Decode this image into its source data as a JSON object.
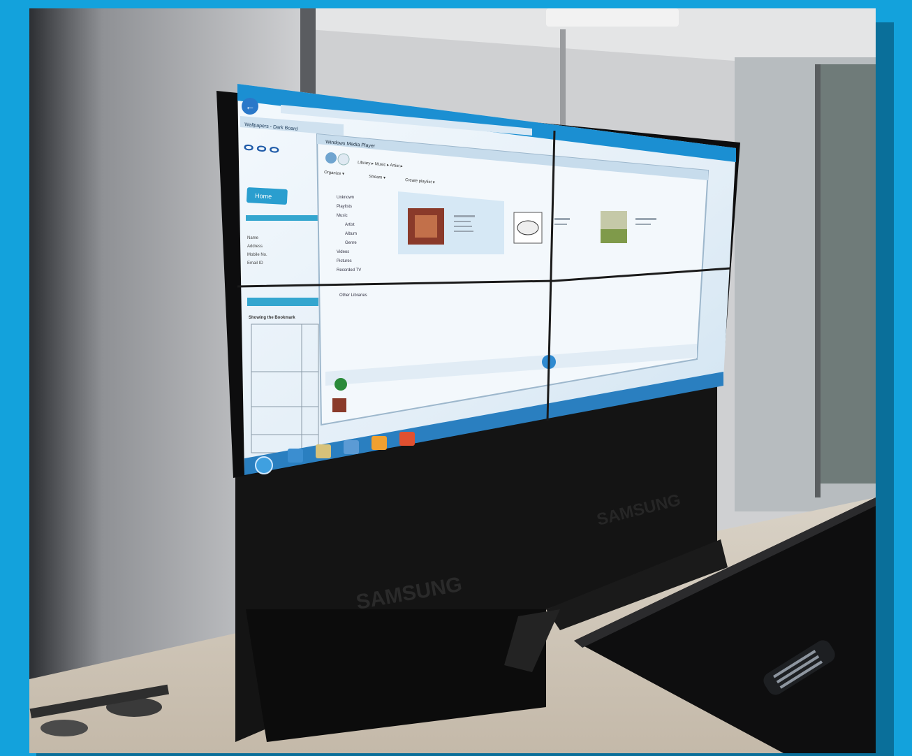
{
  "photo": {
    "brand_front": "SAMSUNG",
    "brand_side": "SAMSUNG"
  },
  "media_player": {
    "window_title": "Windows Media Player",
    "breadcrumb": "Library ▸ Music ▸ Artist ▸",
    "toolbar": [
      "Organize ▾",
      "Stream ▾",
      "Create playlist ▾"
    ],
    "nav_items": [
      "Unknown",
      "Playlists",
      "Music",
      "Artist",
      "Album",
      "Genre",
      "Videos",
      "Pictures",
      "Recorded TV"
    ],
    "other_libraries": "Other Libraries"
  },
  "browser": {
    "tab_label": "Wallpapers - Dark Board",
    "home_tab": "Home",
    "fields": [
      "Name",
      "Address",
      "Mobile No.",
      "Email ID"
    ],
    "section_heading": "Showing the Bookmark"
  },
  "colors": {
    "border_blue": "#13a2dc",
    "screen_glow": "#dfeef8",
    "taskbar": "#2a7fc0",
    "cabinet": "#141414"
  }
}
